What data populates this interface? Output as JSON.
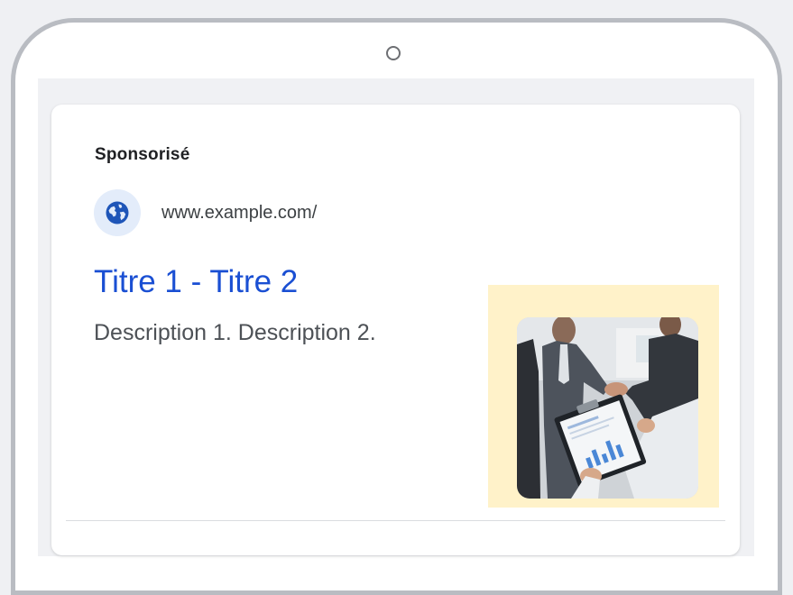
{
  "ad": {
    "sponsored_label": "Sponsorisé",
    "display_url": "www.example.com/",
    "headline": "Titre 1 - Titre 2",
    "description": "Description 1. Description 2."
  },
  "icons": {
    "favicon": "globe-icon",
    "camera": "front-camera-icon"
  },
  "colors": {
    "headline": "#1a4fd3",
    "favicon_bg": "#e3ecfa",
    "favicon_icon": "#1e55b8",
    "image_frame_bg": "#fff2c9"
  }
}
